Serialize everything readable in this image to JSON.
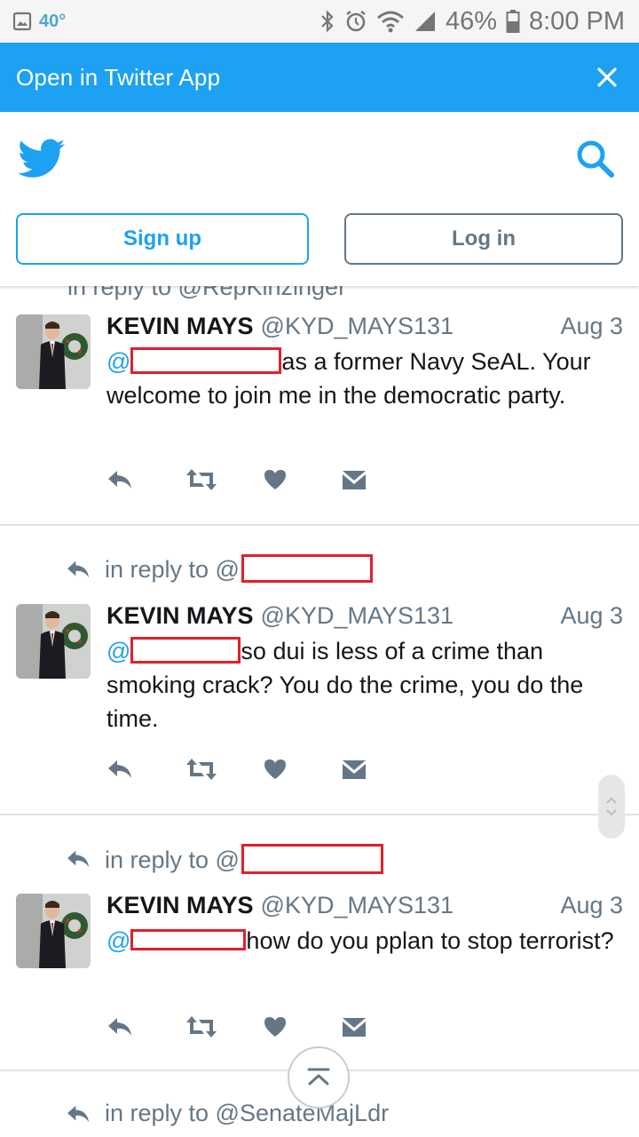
{
  "status_bar": {
    "temperature": "40°",
    "battery": "46%",
    "time": "8:00 PM"
  },
  "banner": {
    "label": "Open in Twitter App"
  },
  "header": {
    "signup_label": "Sign up",
    "login_label": "Log in"
  },
  "timeline": {
    "clipped_reply_text": "in reply to @RepKinzinger",
    "tweets": [
      {
        "name": "KEVIN MAYS",
        "handle": "@KYD_MAYS131",
        "date": "Aug 3",
        "mention": "@",
        "text": "as a  former Navy SeAL. Your welcome to join me in the democratic party."
      },
      {
        "reply_to": "in reply to @",
        "name": "KEVIN MAYS",
        "handle": "@KYD_MAYS131",
        "date": "Aug 3",
        "mention": "@",
        "text": "so dui is less of a crime than smoking crack? You do the crime, you do the time."
      },
      {
        "reply_to": "in reply to @",
        "name": "KEVIN MAYS",
        "handle": "@KYD_MAYS131",
        "date": "Aug 3",
        "mention": "@",
        "text": "how do you pplan to stop terrorist?"
      }
    ],
    "last_reply_to": "in reply to @SenateMajLdr"
  },
  "colors": {
    "twitter_blue": "#1da1f2",
    "gray_text": "#657786",
    "redaction": "#e0202a"
  }
}
